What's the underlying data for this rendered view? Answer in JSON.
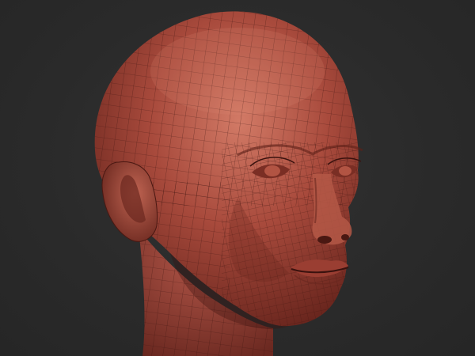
{
  "scene": {
    "background_color": "#2b2b2b",
    "material_color": "#a84a3c",
    "material_shadow_color": "#5e1f18",
    "material_highlight_color": "#d27a66",
    "wireframe_color": "#3a120e",
    "subject": "head-sculpt-with-wireframe"
  }
}
